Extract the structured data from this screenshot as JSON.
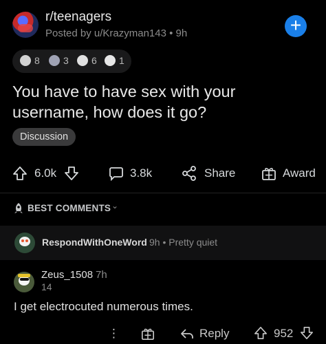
{
  "post": {
    "subreddit": "r/teenagers",
    "posted_by": "Posted by u/Krazyman143 • 9h",
    "join_symbol": "+",
    "awards": [
      {
        "icon": "silver-award-icon",
        "count": "8"
      },
      {
        "icon": "helpful-award-icon",
        "count": "3"
      },
      {
        "icon": "wholesome-award-icon",
        "count": "6"
      },
      {
        "icon": "snoo-award-icon",
        "count": "1"
      }
    ],
    "title": "You have to have sex with your username, how does it go?",
    "flair": "Discussion",
    "votes": "6.0k",
    "comments": "3.8k",
    "share_label": "Share",
    "award_label": "Award"
  },
  "sort": {
    "label": "BEST COMMENTS",
    "chevron": "⌄"
  },
  "pinned_comment": {
    "user": "RespondWithOneWord",
    "meta": "9h • Pretty quiet"
  },
  "comment": {
    "user": "Zeus_1508",
    "time": "7h",
    "flair": "14",
    "body": "I get electrocuted numerous times.",
    "more": "⋮",
    "reply_label": "Reply",
    "votes": "952"
  },
  "colors": {
    "background": "#000000",
    "accent_blue": "#1a7fe8",
    "flair_bg": "#3a3a3b"
  }
}
